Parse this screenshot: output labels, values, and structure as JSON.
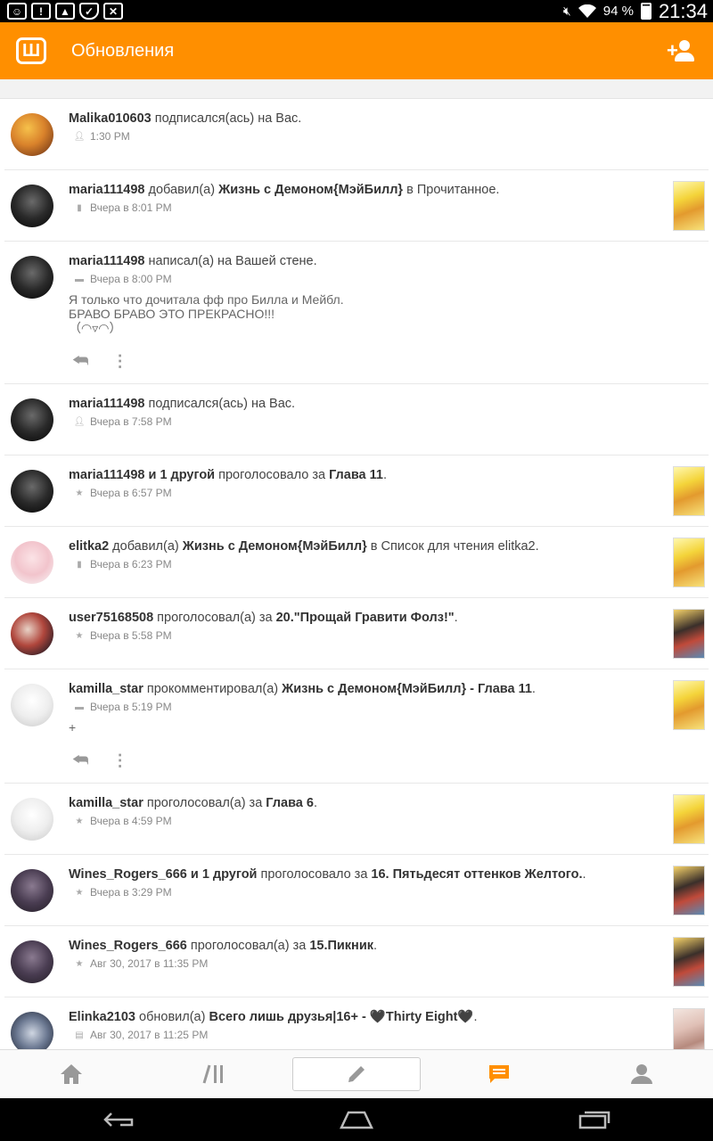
{
  "status_bar": {
    "battery": "94 %",
    "time": "21:34",
    "icons": [
      "notification-face-icon",
      "alert-icon",
      "image-icon",
      "shield-icon",
      "calc-icon",
      "mute-icon",
      "wifi-icon",
      "battery-icon"
    ]
  },
  "appbar": {
    "logo_letter": "Ш",
    "title": "Обновления",
    "add_friend_icon": "add-friend-icon"
  },
  "colors": {
    "accent": "#ff8f00",
    "text": "#333333",
    "meta": "#888888"
  },
  "feed": [
    {
      "user": "Malika010603",
      "mid": " подписался(ась) на Вас.",
      "obj": "",
      "tail": "",
      "meta_icon": "follow-icon",
      "time": "1:30 PM",
      "avatar": "autumn",
      "thumb": ""
    },
    {
      "user": "maria111498",
      "mid": " добавил(а) ",
      "obj": "Жизнь с Демоном{МэйБилл}",
      "tail": " в Прочитанное.",
      "meta_icon": "library-icon",
      "time": "Вчера в 8:01 PM",
      "avatar": "dark",
      "thumb": "yellow"
    },
    {
      "user": "maria111498",
      "mid": " написал(а) на Вашей стене.",
      "obj": "",
      "tail": "",
      "meta_icon": "comment-icon",
      "time": "Вчера в 8:00 PM",
      "avatar": "dark",
      "thumb": "",
      "message": "Я только что дочитала фф про Билла и Мейбл.\nБРАВО БРАВО ЭТО ПРЕКРАСНО!!!\n（◠▿◠）",
      "has_actions": true
    },
    {
      "user": "maria111498",
      "mid": " подписался(ась) на Вас.",
      "obj": "",
      "tail": "",
      "meta_icon": "follow-icon",
      "time": "Вчера в 7:58 PM",
      "avatar": "dark",
      "thumb": ""
    },
    {
      "user": "maria111498 и 1 другой",
      "mid": " проголосовало за ",
      "obj": "Глава 11",
      "tail": ".",
      "meta_icon": "star-icon",
      "time": "Вчера в 6:57 PM",
      "avatar": "dark",
      "thumb": "yellow"
    },
    {
      "user": "elitka2",
      "mid": " добавил(а) ",
      "obj": "Жизнь с Демоном{МэйБилл}",
      "tail": " в Список для чтения elitka2.",
      "meta_icon": "library-icon",
      "time": "Вчера в 6:23 PM",
      "avatar": "pink",
      "thumb": "yellow"
    },
    {
      "user": "user75168508",
      "mid": " проголосовал(а) за ",
      "obj": "20.\"Прощай Гравити Фолз!\"",
      "tail": ".",
      "meta_icon": "star-icon",
      "time": "Вчера в 5:58 PM",
      "avatar": "red",
      "thumb": "duo"
    },
    {
      "user": "kamilla_star",
      "mid": " прокомментировал(а) ",
      "obj": "Жизнь с Демоном{МэйБилл} - Глава 11",
      "tail": ".",
      "meta_icon": "comment-icon",
      "time": "Вчера в 5:19 PM",
      "avatar": "sketch",
      "thumb": "yellow",
      "message": "+",
      "has_actions": true
    },
    {
      "user": "kamilla_star",
      "mid": " проголосовал(а) за ",
      "obj": "Глава 6",
      "tail": ".",
      "meta_icon": "star-icon",
      "time": "Вчера в 4:59 PM",
      "avatar": "sketch",
      "thumb": "yellow"
    },
    {
      "user": "Wines_Rogers_666 и 1 другой",
      "mid": " проголосовало за ",
      "obj": "16. Пятьдесят оттенков Желтого.",
      "tail": ".",
      "meta_icon": "star-icon",
      "time": "Вчера в 3:29 PM",
      "avatar": "purple",
      "thumb": "duo"
    },
    {
      "user": "Wines_Rogers_666",
      "mid": " проголосовал(а) за ",
      "obj": "15.Пикник",
      "tail": ".",
      "meta_icon": "star-icon",
      "time": "Авг 30, 2017 в 11:35 PM",
      "avatar": "purple",
      "thumb": "duo"
    },
    {
      "user": "Elinka2103",
      "mid": " обновил(а) ",
      "obj": "Всего лишь друзья|16+ - 🖤Thirty Eight🖤",
      "tail": ".",
      "meta_icon": "book-icon",
      "time": "Авг 30, 2017 в 11:25 PM",
      "avatar": "cat",
      "thumb": "kiss"
    }
  ],
  "bottom_nav": [
    {
      "icon": "home-icon",
      "active": false
    },
    {
      "icon": "library-nav-icon",
      "active": false
    },
    {
      "icon": "pencil-icon",
      "active": false
    },
    {
      "icon": "messages-icon",
      "active": true
    },
    {
      "icon": "profile-icon",
      "active": false
    }
  ],
  "system_nav": [
    "back-icon",
    "home-sys-icon",
    "recents-icon"
  ]
}
